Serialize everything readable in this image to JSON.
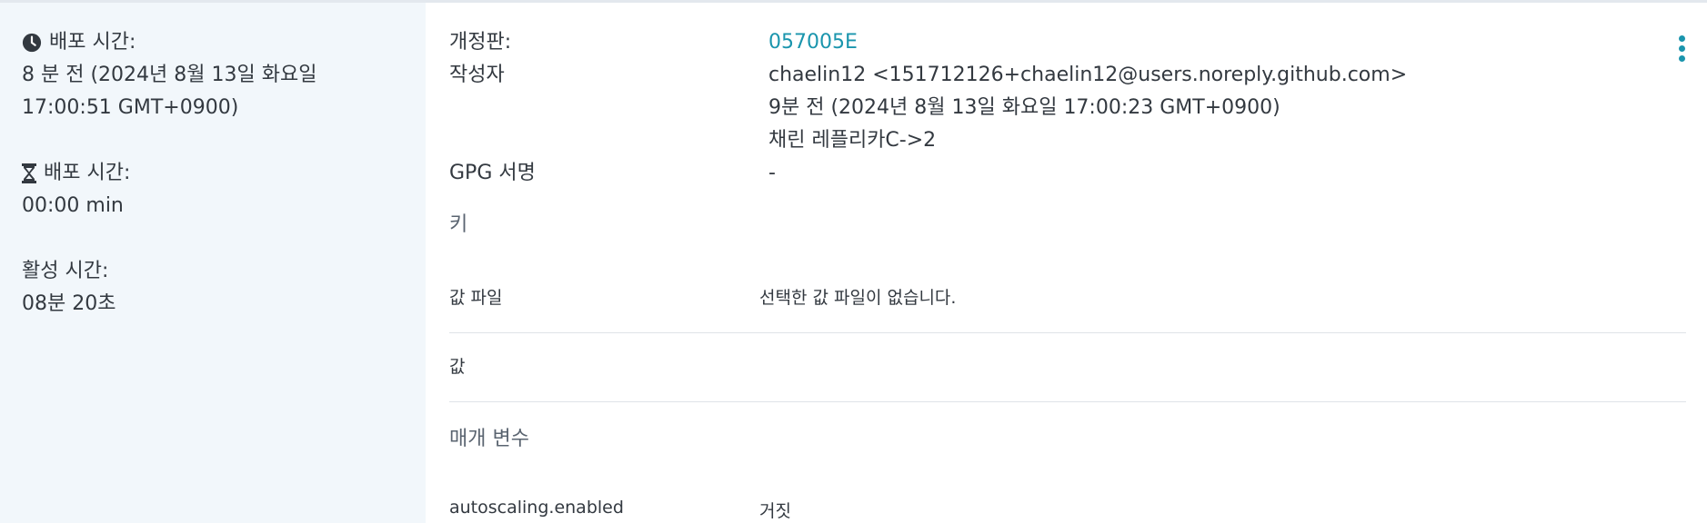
{
  "left": {
    "deploy_time_label": "배포 시간:",
    "deploy_time_value_line1": "8 분 전 (2024년 8월 13일 화요일",
    "deploy_time_value_line2": "17:00:51 GMT+0900)",
    "duration_label": "배포 시간:",
    "duration_value": "00:00 min",
    "active_time_label": "활성 시간:",
    "active_time_value": "08분 20초"
  },
  "revision": {
    "label": "개정판:",
    "value": "057005E"
  },
  "author": {
    "label": "작성자",
    "name": "chaelin12 <151712126+chaelin12@users.noreply.github.com>",
    "time": "9분 전 (2024년 8월 13일 화요일 17:00:23 GMT+0900)",
    "message": "채린 레플리카C->2"
  },
  "gpg": {
    "label": "GPG 서명",
    "value": "-"
  },
  "keys_section": {
    "title": "키",
    "value_file_label": "값 파일",
    "value_file_value": "선택한 값 파일이 없습니다.",
    "values_label": "값"
  },
  "params_section": {
    "title": "매개 변수",
    "param_name": "autoscaling.enabled",
    "param_value": "거짓"
  },
  "colors": {
    "accent": "#1a95ad",
    "left_panel_bg": "#f2f7fb",
    "divider": "#dfe3e8"
  },
  "icons": {
    "deploy_time": "clock-icon",
    "duration": "hourglass-icon",
    "more": "more-vertical-icon"
  }
}
